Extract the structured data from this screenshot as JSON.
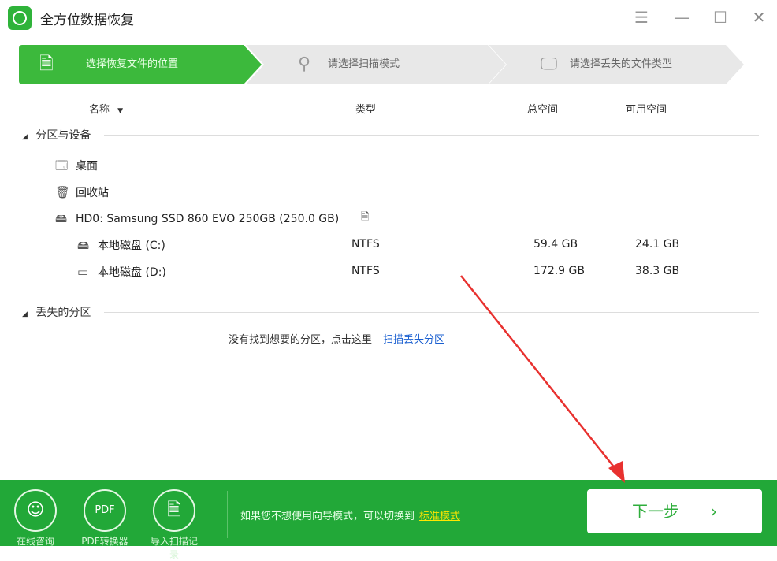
{
  "window": {
    "title": "全方位数据恢复",
    "menu_icon": "hamburger-icon",
    "min_icon": "minimize-icon",
    "max_icon": "maximize-icon",
    "close_icon": "close-icon"
  },
  "steps": [
    {
      "label": "选择恢复文件的位置",
      "icon": "document-icon",
      "active": true
    },
    {
      "label": "请选择扫描模式",
      "icon": "search-icon",
      "active": false
    },
    {
      "label": "请选择丢失的文件类型",
      "icon": "monitor-icon",
      "active": false
    }
  ],
  "columns": {
    "name": "名称",
    "type": "类型",
    "total": "总空间",
    "free": "可用空间"
  },
  "sections": {
    "devices": "分区与设备",
    "lost": "丢失的分区"
  },
  "items": {
    "desktop": "桌面",
    "recycle": "回收站",
    "disk": "HD0: Samsung SSD 860 EVO 250GB (250.0 GB)"
  },
  "partitions": [
    {
      "name": "本地磁盘 (C:)",
      "type": "NTFS",
      "total": "59.4 GB",
      "free": "24.1 GB"
    },
    {
      "name": "本地磁盘 (D:)",
      "type": "NTFS",
      "total": "172.9 GB",
      "free": "38.3 GB"
    }
  ],
  "hint": {
    "text": "没有找到想要的分区，点击这里",
    "link": "扫描丢失分区"
  },
  "footer": {
    "buttons": [
      "在线咨询",
      "PDF转换器",
      "导入扫描记录"
    ],
    "text": "如果您不想使用向导模式，可以切换到",
    "link": "标准模式",
    "next": "下一步"
  },
  "colors": {
    "accent": "#3cb93c",
    "footer": "#22a838",
    "annotation_arrow": "#e8312f"
  }
}
